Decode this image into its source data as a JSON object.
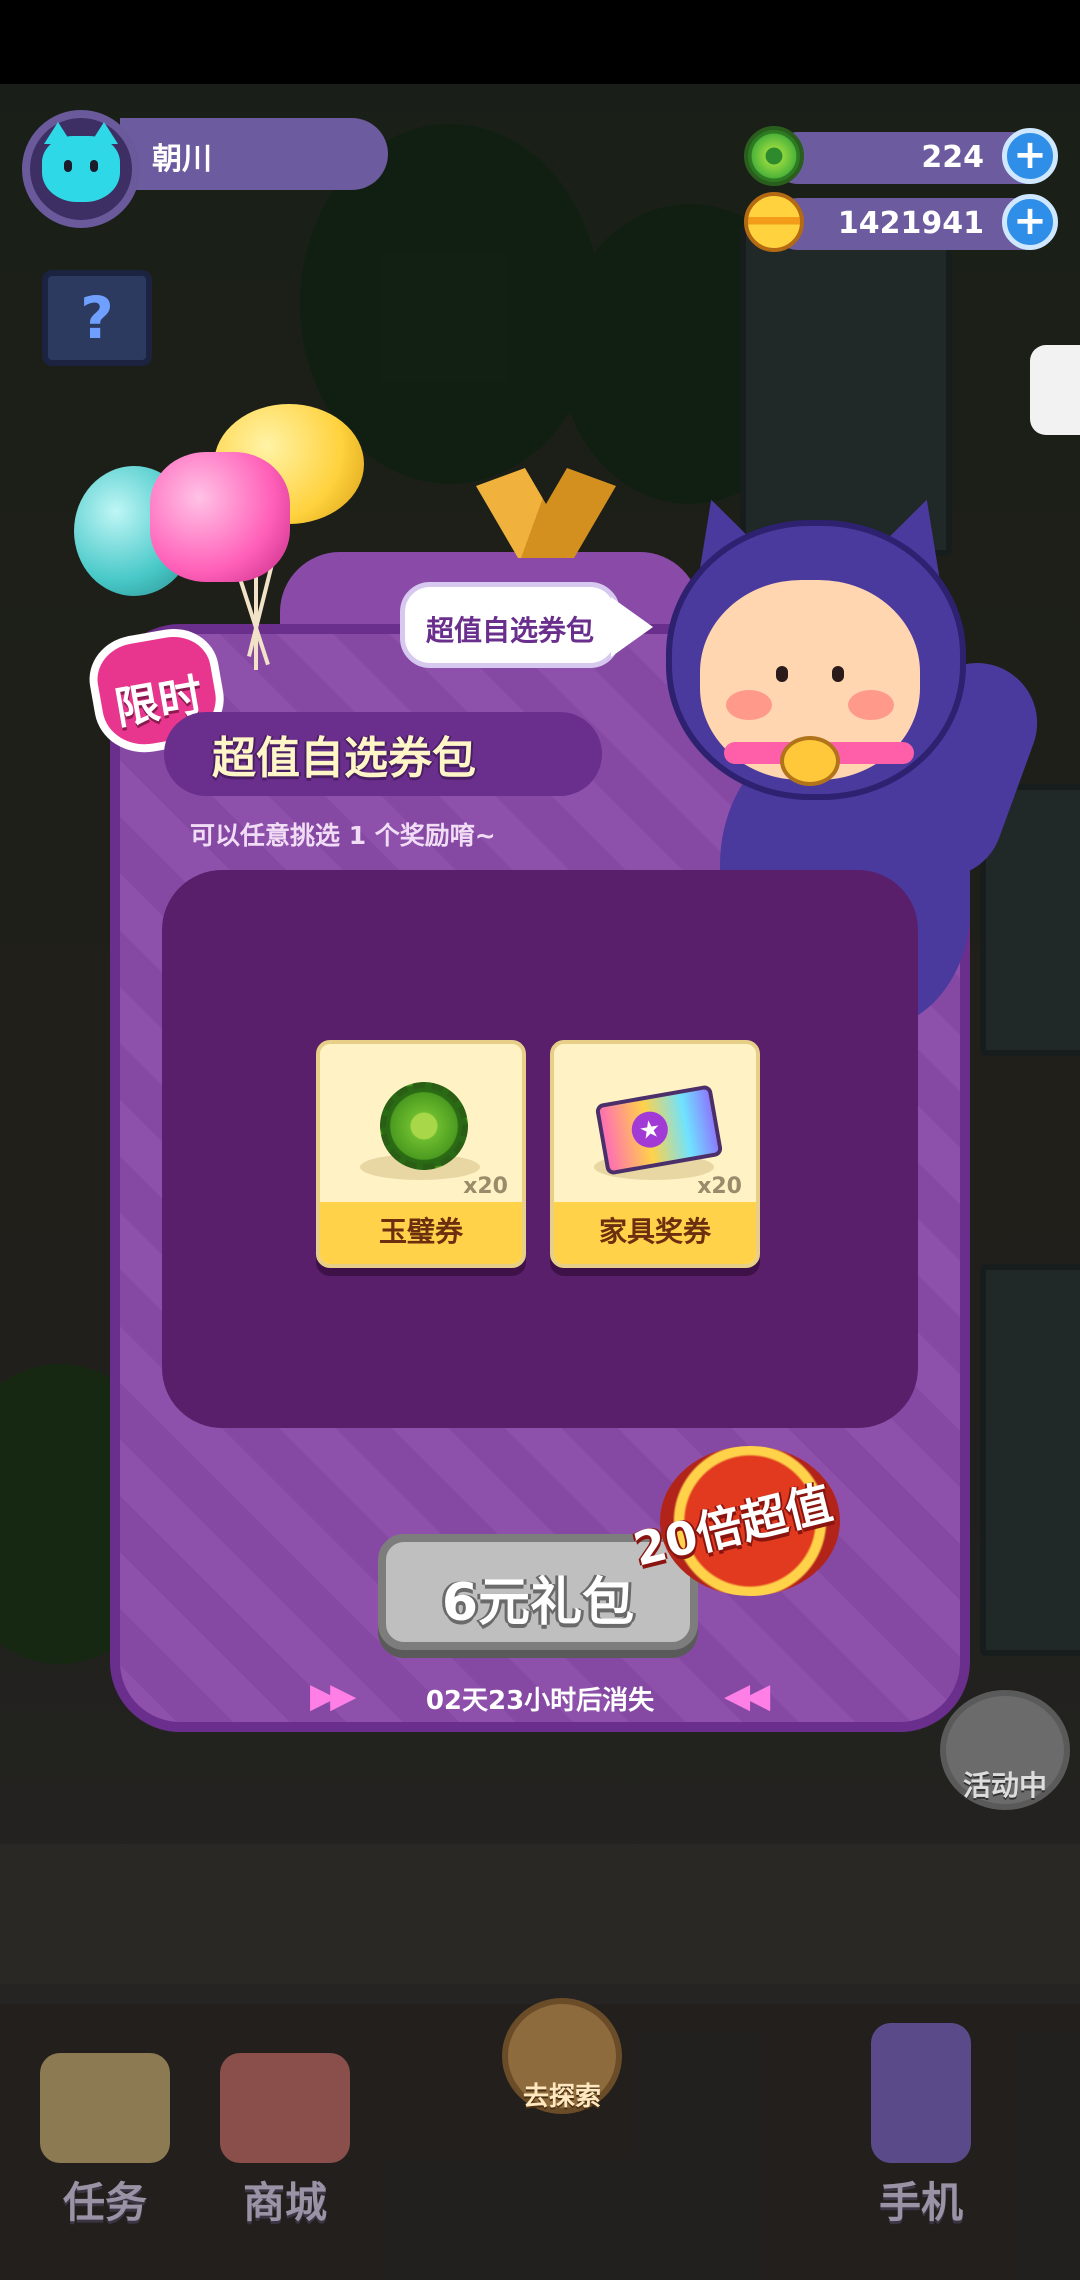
{
  "player": {
    "name": "朝川",
    "avatar_icon": "cat-avatar-icon"
  },
  "currencies": [
    {
      "icon": "jade-coin-icon",
      "value": "224",
      "color": "#4db33a"
    },
    {
      "icon": "gold-planet-coin-icon",
      "value": "1421941",
      "color": "#ffd23e"
    }
  ],
  "popup": {
    "limited_badge": "限时",
    "speech_bubble": "超值自选券包",
    "title": "超值自选券包",
    "subtitle": "可以任意挑选 1 个奖励唷~",
    "rewards": [
      {
        "name": "玉璧券",
        "quantity": "x20",
        "icon": "jade-ticket-icon"
      },
      {
        "name": "家具奖券",
        "quantity": "x20",
        "icon": "furniture-ticket-icon"
      }
    ],
    "price_button": "6元礼包",
    "value_badge": "20倍超值",
    "countdown": "02天23小时后消失",
    "accent_color": "#8a4ba8"
  },
  "side_buttons": {
    "activity": "活动中",
    "explore": "去探索"
  },
  "bottom_nav": [
    {
      "label": "任务",
      "icon": "task-book-icon"
    },
    {
      "label": "商城",
      "icon": "shop-icon"
    },
    {
      "label": "手机",
      "icon": "phone-icon"
    }
  ]
}
